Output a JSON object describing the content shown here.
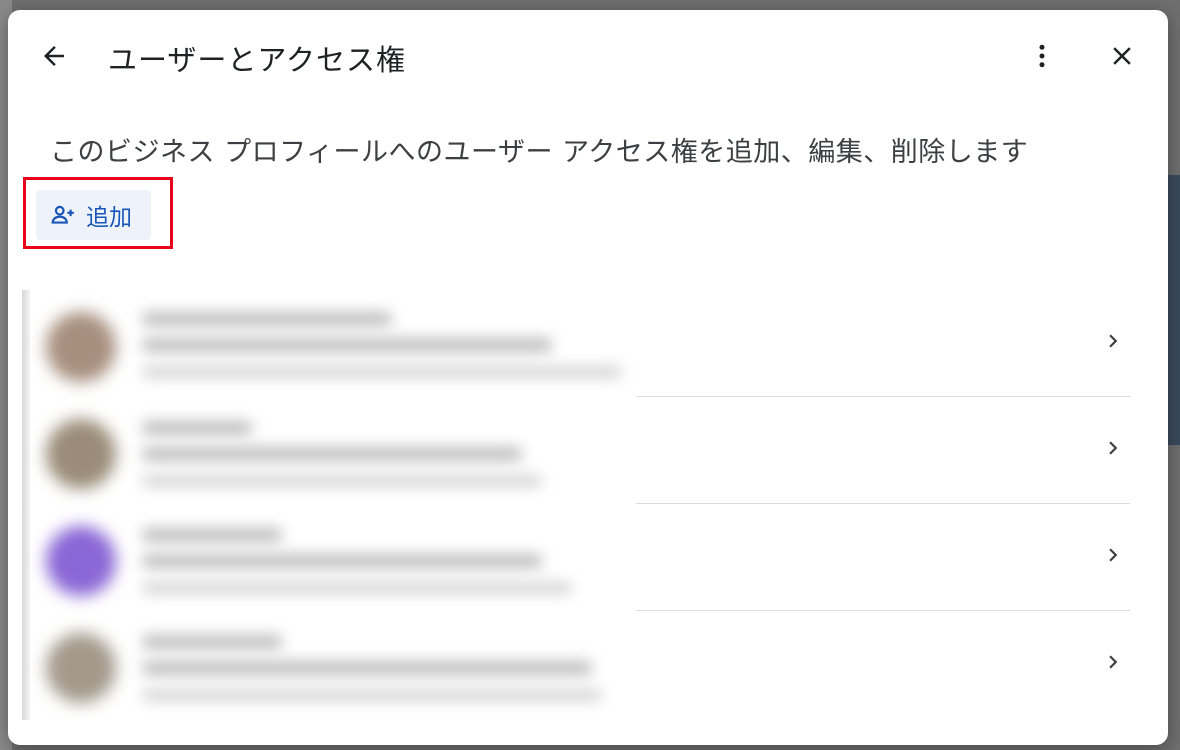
{
  "header": {
    "title": "ユーザーとアクセス権",
    "back_icon": "arrow-back-icon",
    "more_icon": "more-vert-icon",
    "close_icon": "close-icon"
  },
  "description": "このビジネス プロフィールへのユーザー アクセス権を追加、編集、削除します",
  "add_button": {
    "label": "追加",
    "icon": "person-add-icon"
  },
  "users": [
    {
      "avatar_color": "#a78f7e"
    },
    {
      "avatar_color": "#9a8c78"
    },
    {
      "avatar_color": "#8a67d6"
    },
    {
      "avatar_color": "#a49a8c"
    }
  ],
  "colors": {
    "accent": "#1a56b8",
    "highlight_border": "#e8001c",
    "button_bg": "#eef3fb"
  }
}
